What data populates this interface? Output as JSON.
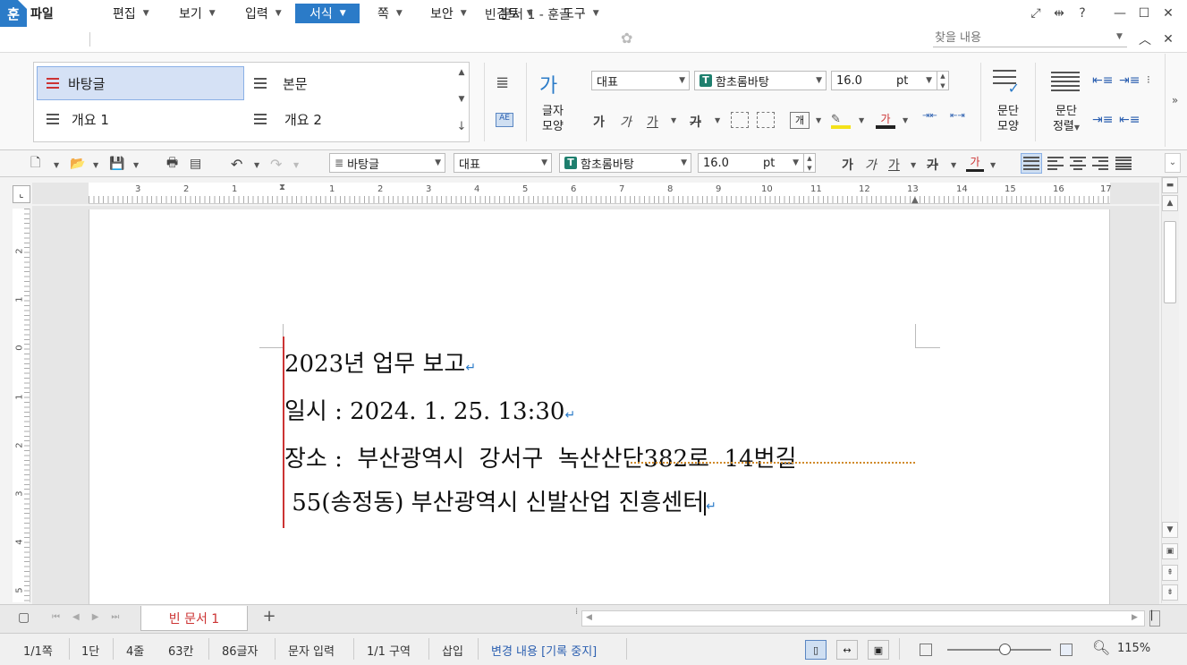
{
  "window": {
    "logo": "훈",
    "title": "빈 문서 1 - 훈글",
    "controls": [
      "⤢",
      "⇹",
      "?",
      "—",
      "☐",
      "✕"
    ]
  },
  "menubar": {
    "file": "파일",
    "items": [
      "편집",
      "보기",
      "입력",
      "서식",
      "쪽",
      "보안",
      "검토",
      "도구"
    ],
    "active": "서식",
    "find_placeholder": "찾을 내용"
  },
  "ribbon": {
    "styles": [
      "바탕글",
      "본문",
      "개요 1",
      "개요 2"
    ],
    "char_shape_label_1": "글자",
    "char_shape_label_2": "모양",
    "para_shape_label_1": "문단",
    "para_shape_label_2": "모양",
    "para_align_label_1": "문단",
    "para_align_label_2": "정렬",
    "lang": "대표",
    "font": "함초롬바탕",
    "size": "16.0",
    "unit": "pt",
    "char_buttons": [
      "가",
      "가",
      "가",
      "가"
    ]
  },
  "toolbar": {
    "style": "바탕글",
    "lang": "대표",
    "font": "함초롬바탕",
    "size": "16.0",
    "unit": "pt"
  },
  "ruler": {
    "h_labels": [
      "3",
      "2",
      "1",
      "1",
      "2",
      "3",
      "4",
      "5",
      "6",
      "7",
      "8",
      "9",
      "10",
      "11",
      "12",
      "13",
      "14",
      "15",
      "16",
      "17"
    ],
    "v_labels": [
      "2",
      "1",
      "0",
      "1",
      "2",
      "3",
      "4",
      "5"
    ]
  },
  "document": {
    "lines": [
      "2023년 업무 보고",
      "일시 : 2024. 1. 25. 13:30",
      "장소 :  부산광역시  강서구  녹산산단382로  14번길",
      " 55(송정동) 부산광역시 신발산업 진흥센터"
    ],
    "squiggle_word": "녹산산단382로"
  },
  "tabs": {
    "active_tab": "빈 문서 1",
    "add": "+"
  },
  "status": {
    "page": "1/1쪽",
    "column": "1단",
    "line": "4줄",
    "col": "63칸",
    "chars": "86글자",
    "mode": "문자 입력",
    "section": "1/1 구역",
    "insert": "삽입",
    "track": "변경 내용 [기록 중지]",
    "zoom": "115%",
    "zoom_level": 0.55
  }
}
